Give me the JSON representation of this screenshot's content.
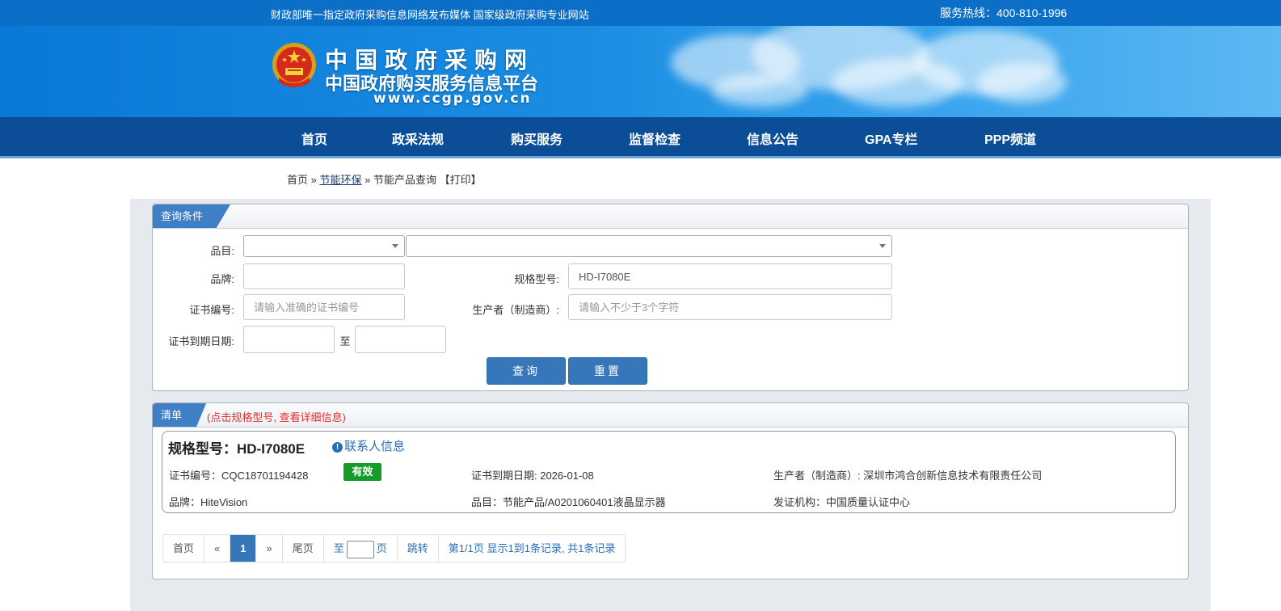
{
  "header": {
    "slogan": "财政部唯一指定政府采购信息网络发布媒体 国家级政府采购专业网站",
    "hotline": "服务热线：400-810-1996",
    "logo_line1": "中国政府采购网",
    "logo_line2": "中国政府购买服务信息平台",
    "logo_url": "www.ccgp.gov.cn"
  },
  "nav": {
    "items": [
      "首页",
      "政采法规",
      "购买服务",
      "监督检查",
      "信息公告",
      "GPA专栏",
      "PPP频道"
    ]
  },
  "breadcrumb": {
    "home": "首页",
    "sep1": "»",
    "section": "节能环保",
    "sep2": "»",
    "current": "节能产品查询",
    "print": "【打印】"
  },
  "query": {
    "panel_title": "查询条件",
    "category_label": "品目:",
    "brand_label": "品牌:",
    "brand_value": "",
    "model_label": "规格型号:",
    "model_value": "HD-I7080E",
    "cert_no_label": "证书编号:",
    "cert_no_placeholder": "请输入准确的证书编号",
    "maker_label": "生产者（制造商）:",
    "maker_placeholder": "请输入不少于3个字符",
    "expire_label": "证书到期日期:",
    "to_label": "至",
    "search_button": "查询",
    "reset_button": "重置"
  },
  "list": {
    "panel_title": "清单",
    "hint": "(点击规格型号, 查看详细信息)",
    "item": {
      "title": "规格型号：HD-I7080E",
      "contact": "联系人信息",
      "cert_no": "证书编号：CQC18701194428",
      "status": "有效",
      "expire": "证书到期日期: 2026-01-08",
      "maker": "生产者（制造商）: 深圳市鸿合创新信息技术有限责任公司",
      "brand": "品牌：HiteVision",
      "category": "品目：节能产品/A0201060401液晶显示器",
      "issuer": "发证机构：中国质量认证中心"
    }
  },
  "pager": {
    "first": "首页",
    "prev": "«",
    "current": "1",
    "next": "»",
    "last": "尾页",
    "goto_prefix": "至",
    "goto_suffix": "页",
    "jump": "跳转",
    "summary": "第1/1页  显示1到1条记录, 共1条记录"
  },
  "colors": {
    "topbar": "#0c6fc7",
    "nav": "#0b4d96",
    "accent": "#3577b8",
    "valid_badge": "#179c29",
    "hint": "#e03030"
  }
}
